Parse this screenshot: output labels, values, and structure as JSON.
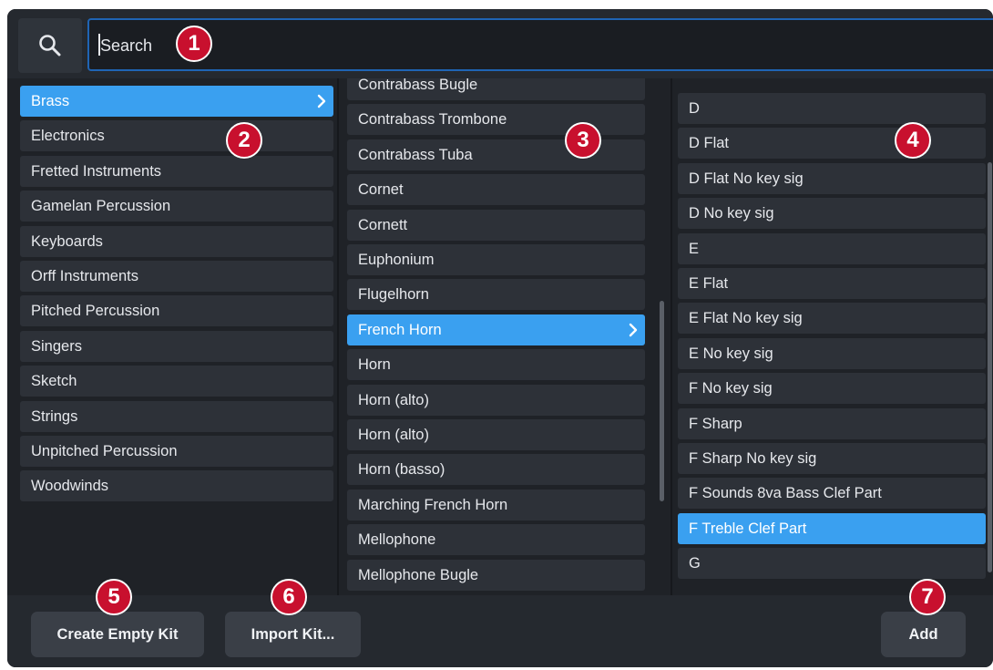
{
  "search": {
    "placeholder": "Search"
  },
  "categories": {
    "items": [
      {
        "label": "Brass",
        "selected": true
      },
      {
        "label": "Electronics"
      },
      {
        "label": "Fretted Instruments"
      },
      {
        "label": "Gamelan Percussion"
      },
      {
        "label": "Keyboards"
      },
      {
        "label": "Orff Instruments"
      },
      {
        "label": "Pitched Percussion"
      },
      {
        "label": "Singers"
      },
      {
        "label": "Sketch"
      },
      {
        "label": "Strings"
      },
      {
        "label": "Unpitched Percussion"
      },
      {
        "label": "Woodwinds"
      }
    ]
  },
  "instruments": {
    "items": [
      {
        "label": "Contrabass Bugle"
      },
      {
        "label": "Contrabass Trombone"
      },
      {
        "label": "Contrabass Tuba"
      },
      {
        "label": "Cornet"
      },
      {
        "label": "Cornett"
      },
      {
        "label": "Euphonium"
      },
      {
        "label": "Flugelhorn"
      },
      {
        "label": "French Horn",
        "selected": true
      },
      {
        "label": "Horn"
      },
      {
        "label": "Horn (alto)"
      },
      {
        "label": "Horn (alto)"
      },
      {
        "label": "Horn (basso)"
      },
      {
        "label": "Marching French Horn"
      },
      {
        "label": "Mellophone"
      },
      {
        "label": "Mellophone Bugle"
      }
    ]
  },
  "variants": {
    "items": [
      {
        "label": "D"
      },
      {
        "label": "D Flat"
      },
      {
        "label": "D Flat No key sig"
      },
      {
        "label": "D No key sig"
      },
      {
        "label": "E"
      },
      {
        "label": "E Flat"
      },
      {
        "label": "E Flat No key sig"
      },
      {
        "label": "E No key sig"
      },
      {
        "label": "F No key sig"
      },
      {
        "label": "F Sharp"
      },
      {
        "label": "F Sharp No key sig"
      },
      {
        "label": "F Sounds 8va Bass Clef Part"
      },
      {
        "label": "F Treble Clef Part",
        "selected": true
      },
      {
        "label": "G"
      }
    ]
  },
  "footer": {
    "create_empty_kit": "Create Empty Kit",
    "import_kit": "Import Kit...",
    "add": "Add"
  },
  "callouts": [
    "1",
    "2",
    "3",
    "4",
    "5",
    "6",
    "7"
  ],
  "colors": {
    "background": "#1f2227",
    "item": "#2d3138",
    "selected": "#3aa0f0",
    "badge": "#c8102e",
    "focus_border": "#1f64b4"
  }
}
